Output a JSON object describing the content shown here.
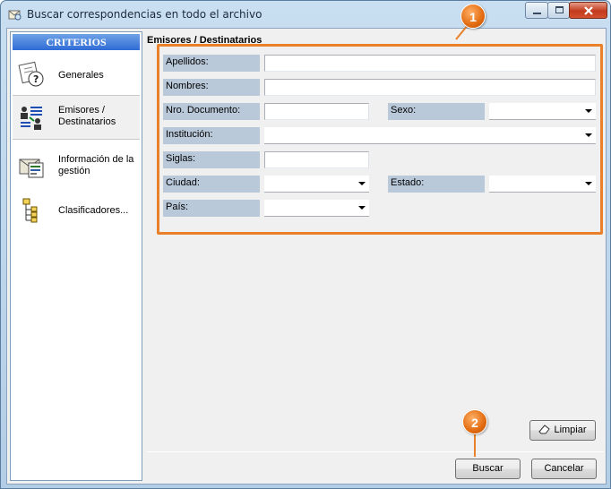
{
  "window": {
    "title": "Buscar correspondencias en todo el archivo"
  },
  "criteria": {
    "header": "CRITERIOS",
    "items": [
      {
        "label": "Generales",
        "icon": "question-document-icon"
      },
      {
        "label": "Emisores / Destinatarios",
        "icon": "people-list-icon",
        "selected": true
      },
      {
        "label": "Información de la gestión",
        "icon": "form-document-icon"
      },
      {
        "label": "Clasificadores...",
        "icon": "tree-hierarchy-icon"
      }
    ]
  },
  "form": {
    "section_title": "Emisores / Destinatarios",
    "fields": {
      "apellidos": {
        "label": "Apellidos:",
        "value": ""
      },
      "nombres": {
        "label": "Nombres:",
        "value": ""
      },
      "nro_documento": {
        "label": "Nro. Documento:",
        "value": ""
      },
      "sexo": {
        "label": "Sexo:",
        "value": ""
      },
      "institucion": {
        "label": "Institución:",
        "value": ""
      },
      "siglas": {
        "label": "Siglas:",
        "value": ""
      },
      "ciudad": {
        "label": "Ciudad:",
        "value": ""
      },
      "estado": {
        "label": "Estado:",
        "value": ""
      },
      "pais": {
        "label": "País:",
        "value": ""
      }
    }
  },
  "buttons": {
    "limpiar": "Limpiar",
    "buscar": "Buscar",
    "cancelar": "Cancelar"
  },
  "annotations": {
    "callout_1": "1",
    "callout_2": "2"
  },
  "colors": {
    "highlight": "#e8812a",
    "label_bg": "#b9c9da",
    "criteria_header": "#2f6bd6"
  }
}
